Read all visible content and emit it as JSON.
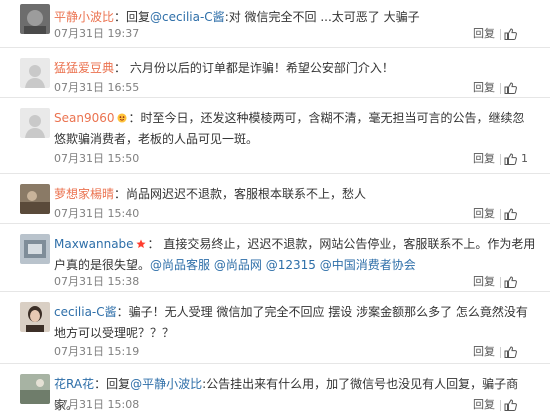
{
  "comments": [
    {
      "username": "平静小波比",
      "badge": "",
      "body": [
        {
          "t": "：回复",
          "m": false
        },
        {
          "t": "@cecilia-C酱",
          "m": true
        },
        {
          "t": ":对 微信完全不回 ...太可恶了 大骗子",
          "m": false
        }
      ],
      "time": "07月31日 19:37",
      "reply": "回复",
      "likes": ""
    },
    {
      "username": "猛猛爱豆典",
      "badge": "",
      "body": [
        {
          "t": "： 六月份以后的订单都是诈骗！希望公安部门介入！",
          "m": false
        }
      ],
      "time": "07月31日 16:55",
      "reply": "回复",
      "likes": ""
    },
    {
      "username": "Sean9060",
      "badge": "",
      "body": [
        {
          "t": "：时至今日，还发这种模棱两可，含糊不清，毫无担当可言的公告，继续忽悠欺骗消费者，老板的人品可见一斑。",
          "m": false
        }
      ],
      "time": "07月31日 15:50",
      "reply": "回复",
      "likes": "1"
    },
    {
      "username": "萝想家楊晴",
      "badge": "",
      "body": [
        {
          "t": "：尚品网迟迟不退款，客服根本联系不上，愁人",
          "m": false
        }
      ],
      "time": "07月31日 15:40",
      "reply": "回复",
      "likes": ""
    },
    {
      "username": "Maxwannabe",
      "badge": "",
      "body": [
        {
          "t": "： 直接交易终止，迟迟不退款，网站公告停业，客服联系不上。作为老用户真的是很失望。",
          "m": false
        },
        {
          "t": "@尚品客服",
          "m": true
        },
        {
          "t": " ",
          "m": false
        },
        {
          "t": "@尚品网",
          "m": true
        },
        {
          "t": " ",
          "m": false
        },
        {
          "t": "@12315",
          "m": true
        },
        {
          "t": " ",
          "m": false
        },
        {
          "t": "@中国消费者协会",
          "m": true
        }
      ],
      "time": "07月31日 15:38",
      "reply": "回复",
      "likes": ""
    },
    {
      "username": "cecilia-C酱",
      "badge": "",
      "body": [
        {
          "t": "：骗子！无人受理 微信加了完全不回应 摆设 涉案金额那么多了 怎么竟然没有地方可以受理呢？？？",
          "m": false
        }
      ],
      "time": "07月31日 15:19",
      "reply": "回复",
      "likes": ""
    },
    {
      "username": "花RA花",
      "badge": "",
      "body": [
        {
          "t": "：回复",
          "m": false
        },
        {
          "t": "@平静小波比",
          "m": true
        },
        {
          "t": ":公告挂出来有什么用，加了微信号也没见有人回复，骗子商家。",
          "m": false
        }
      ],
      "time": "07月31日 15:08",
      "reply": "回复",
      "likes": ""
    }
  ],
  "colors": {
    "username": "#eb7350",
    "mention": "#2d6ea8",
    "meta": "#808080",
    "border": "#e6e6e6"
  }
}
